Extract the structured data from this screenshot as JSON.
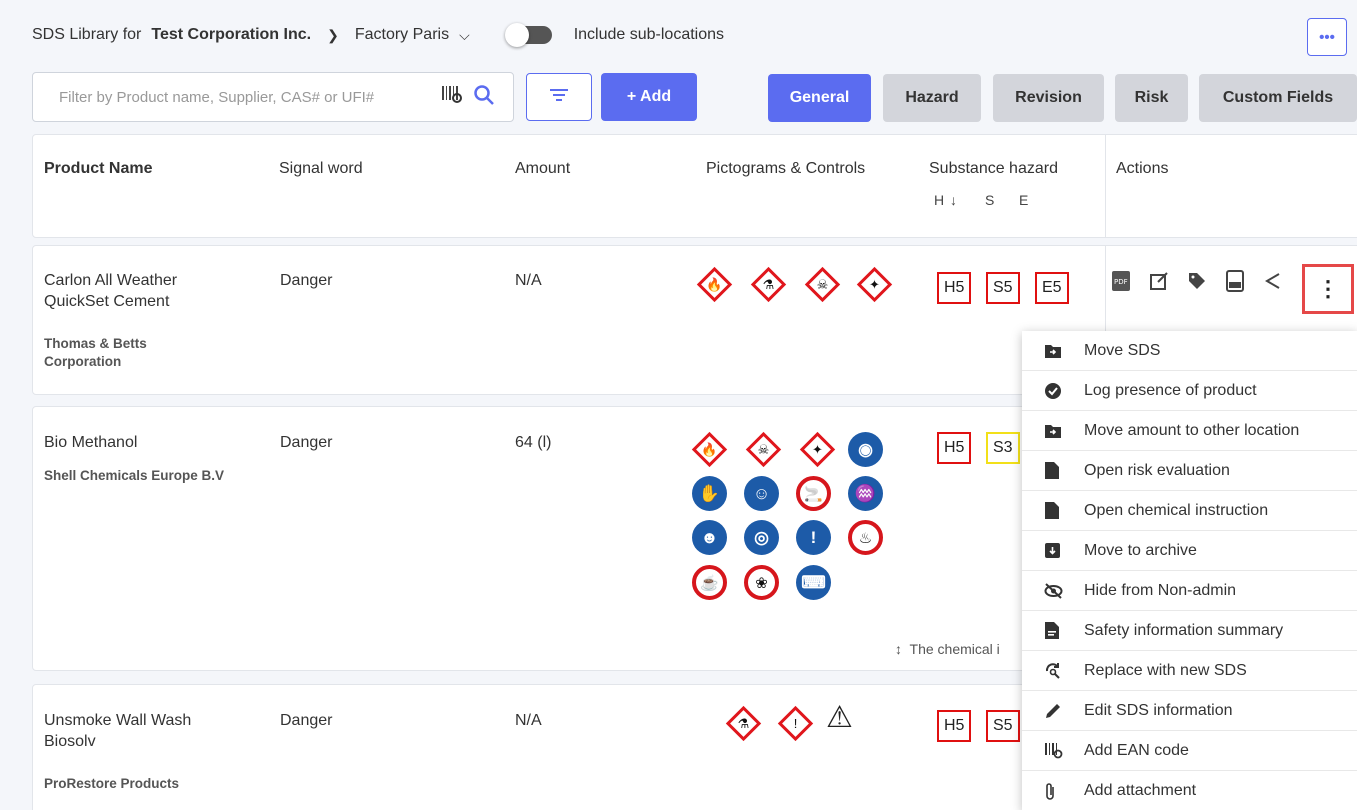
{
  "header": {
    "prefix": "SDS Library for",
    "company": "Test Corporation Inc.",
    "location": "Factory Paris",
    "include_sub_locations": "Include sub-locations",
    "more": "•••"
  },
  "toolbar": {
    "filter_placeholder": "Filter by Product name, Supplier, CAS# or UFI#",
    "add_label": "+  Add",
    "tabs": [
      "General",
      "Hazard",
      "Revision",
      "Risk",
      "Custom Fields"
    ],
    "active_tab": "General"
  },
  "table": {
    "columns": [
      "Product Name",
      "Signal word",
      "Amount",
      "Pictograms & Controls",
      "Substance hazard",
      "Actions"
    ],
    "hazard_sub": {
      "h": "H",
      "s": "S",
      "e": "E"
    },
    "rows": [
      {
        "name_line1": "Carlon All Weather",
        "name_line2": "QuickSet Cement",
        "supplier_line1": "Thomas & Betts",
        "supplier_line2": "Corporation",
        "signal": "Danger",
        "amount": "N/A",
        "h": "H5",
        "s": "S5",
        "e": "E5"
      },
      {
        "name_line1": "Bio Methanol",
        "name_line2": "",
        "supplier_line1": "Shell Chemicals Europe B.V",
        "supplier_line2": "",
        "signal": "Danger",
        "amount": "64 (l)",
        "h": "H5",
        "s": "S3",
        "e": ""
      },
      {
        "name_line1": "Unsmoke Wall Wash",
        "name_line2": "Biosolv",
        "supplier_line1": "ProRestore Products",
        "supplier_line2": "",
        "signal": "Danger",
        "amount": "N/A",
        "h": "H5",
        "s": "S5",
        "e": ""
      }
    ],
    "chemical_note": "The chemical i"
  },
  "menu": {
    "items": [
      {
        "label": "Move SDS",
        "icon": "folder-move-icon"
      },
      {
        "label": "Log presence of product",
        "icon": "check-circle-icon"
      },
      {
        "label": "Move amount to other location",
        "icon": "folder-move-icon"
      },
      {
        "label": "Open risk evaluation",
        "icon": "document-icon"
      },
      {
        "label": "Open chemical instruction",
        "icon": "document-icon"
      },
      {
        "label": "Move to archive",
        "icon": "archive-icon"
      },
      {
        "label": "Hide from Non-admin",
        "icon": "eye-off-icon"
      },
      {
        "label": "Safety information summary",
        "icon": "summary-icon"
      },
      {
        "label": "Replace with new SDS",
        "icon": "replace-icon"
      },
      {
        "label": "Edit SDS information",
        "icon": "pencil-icon"
      },
      {
        "label": "Add EAN code",
        "icon": "barcode-icon"
      },
      {
        "label": "Add attachment",
        "icon": "paperclip-icon"
      }
    ]
  },
  "colors": {
    "accent": "#5b6cf0",
    "hazard_red": "#e01010",
    "hazard_yellow": "#f2e019"
  }
}
